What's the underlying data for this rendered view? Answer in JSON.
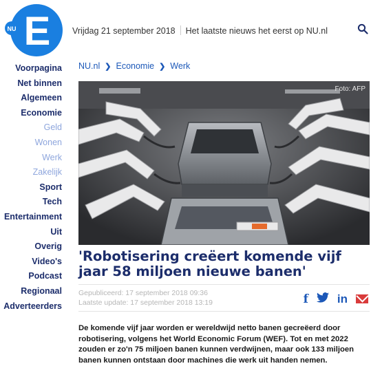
{
  "header": {
    "logo_letter": "E",
    "logo_badge": "NU",
    "date": "Vrijdag 21 september 2018",
    "tagline": "Het laatste nieuws het eerst op NU.nl",
    "brand_color": "#1a7fe0"
  },
  "sidebar": {
    "items": [
      {
        "label": "Voorpagina"
      },
      {
        "label": "Net binnen"
      },
      {
        "label": "Algemeen"
      },
      {
        "label": "Economie"
      },
      {
        "label": "Geld"
      },
      {
        "label": "Wonen"
      },
      {
        "label": "Werk"
      },
      {
        "label": "Zakelijk"
      },
      {
        "label": "Sport"
      },
      {
        "label": "Tech"
      },
      {
        "label": "Entertainment"
      },
      {
        "label": "Uit"
      },
      {
        "label": "Overig"
      },
      {
        "label": "Video's"
      },
      {
        "label": "Podcast"
      },
      {
        "label": "Regionaal"
      },
      {
        "label": "Adverteerders"
      }
    ]
  },
  "breadcrumb": [
    "NU.nl",
    "Economie",
    "Werk"
  ],
  "article": {
    "photo_credit": "Foto: AFP",
    "title": "'Robotisering creëert komende vijf jaar 58 miljoen nieuwe banen'",
    "published": "Gepubliceerd: 17 september 2018 09:36",
    "updated": "Laatste update: 17 september 2018 13:19",
    "lead": "De komende vijf jaar worden er wereldwijd netto banen gecreëerd door robotisering, volgens het World Economic Forum (WEF). Tot en met 2022 zouden er zo'n 75 miljoen banen kunnen verdwijnen, maar ook 133 miljoen banen kunnen ontstaan door machines die werk uit handen nemen."
  },
  "share": {
    "facebook_glyph": "f",
    "linkedin_glyph": "in"
  }
}
